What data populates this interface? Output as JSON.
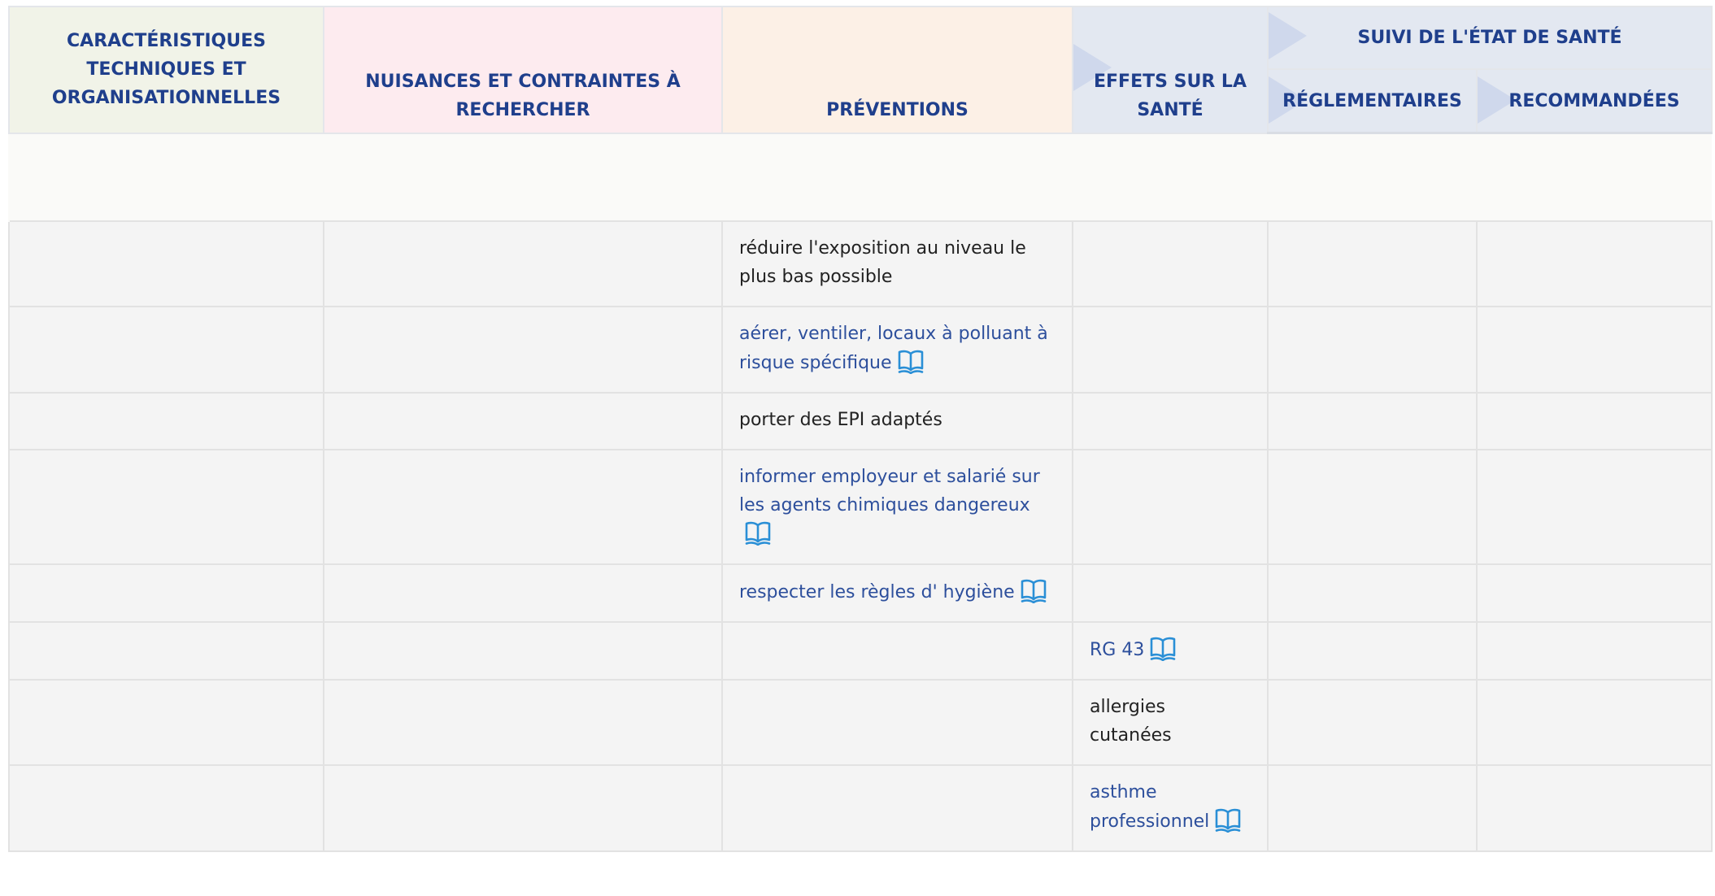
{
  "table": {
    "headers": {
      "caracteristiques": "CARACTÉRISTIQUES TECHNIQUES ET ORGANISATIONNELLES",
      "nuisances": "NUISANCES ET CONTRAINTES À RECHERCHER",
      "preventions": "PRÉVENTIONS",
      "effets": "EFFETS SUR LA SANTÉ",
      "suivi": "SUIVI DE L'ÉTAT DE SANTÉ",
      "reglementaires": "RÉGLEMENTAIRES",
      "recommandees": "RECOMMANDÉES"
    },
    "rows": [
      {
        "prevention": "réduire l'exposition au niveau le plus bas possible",
        "effet": "",
        "link": false
      },
      {
        "prevention": "aérer, ventiler, locaux à polluant à risque spécifique",
        "effet": "",
        "link": true
      },
      {
        "prevention": "porter des EPI adaptés",
        "effet": "",
        "link": false
      },
      {
        "prevention": "informer employeur et salarié sur les agents chimiques dangereux",
        "effet": "",
        "link": true
      },
      {
        "prevention": "respecter les règles d' hygiène",
        "effet": "",
        "link": true
      },
      {
        "prevention": "",
        "effet": "RG 43",
        "link": true
      },
      {
        "prevention": "",
        "effet": "allergies cutanées",
        "link": false
      },
      {
        "prevention": "",
        "effet": "asthme professionnel",
        "link": true
      }
    ]
  },
  "icons": {
    "reference": "book-icon",
    "reference_color": "#2a8fd6"
  },
  "colors": {
    "header_text": "#1f3f8c",
    "link_text": "#2d4f9c",
    "carac_bg": "#f1f3e8",
    "nuisances_bg": "#fdebef",
    "preventions_bg": "#fcf0e6",
    "effets_bg": "#e3e8f1"
  }
}
